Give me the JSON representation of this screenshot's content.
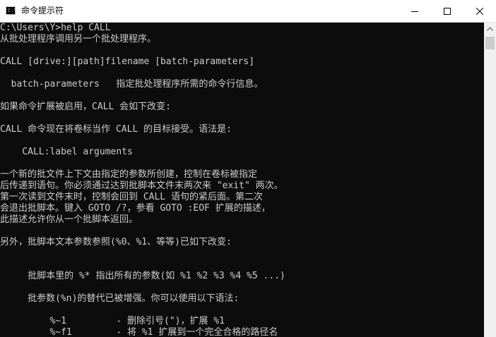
{
  "window": {
    "title": "命令提示符",
    "icon": "cmd-icon",
    "icon_glyph": "C:\\",
    "controls": [
      "minimize-icon",
      "maximize-icon",
      "close-icon"
    ]
  },
  "console": {
    "lines": [
      "C:\\Users\\Y>help CALL",
      "从批处理程序调用另一个批处理程序。",
      "",
      "CALL [drive:][path]filename [batch-parameters]",
      "",
      "  batch-parameters   指定批处理程序所需的命令行信息。",
      "",
      "如果命令扩展被启用，CALL 会如下改变:",
      "",
      "CALL 命令现在将卷标当作 CALL 的目标接受。语法是:",
      "",
      "    CALL:label arguments",
      "",
      "一个新的批文件上下文由指定的参数所创建，控制在卷标被指定",
      "后传递到语句。你必须通过达到批脚本文件末两次来 \"exit\" 两次。",
      "第一次读到文件末时，控制会回到 CALL 语句的紧后面。第二次",
      "会退出批脚本。键入 GOTO /?，参看 GOTO :EOF 扩展的描述，",
      "此描述允许你从一个批脚本返回。",
      "",
      "另外，批脚本文本参数参照(%0、%1、等等)已如下改变:",
      "",
      "",
      "     批脚本里的 %* 指出所有的参数(如 %1 %2 %3 %4 %5 ...)",
      "",
      "     批参数(%n)的替代已被增强。你可以使用以下语法:",
      "",
      "         %~1         - 删除引号(\")，扩展 %1",
      "         %~f1        - 将 %1 扩展到一个完全合格的路径名"
    ]
  },
  "colors": {
    "console_bg": "#0c0c0c",
    "console_fg": "#cccccc",
    "titlebar_bg": "#ffffff",
    "scrollbar_bg": "#f0f0f0",
    "scrollbar_thumb": "#cdcdcd"
  }
}
